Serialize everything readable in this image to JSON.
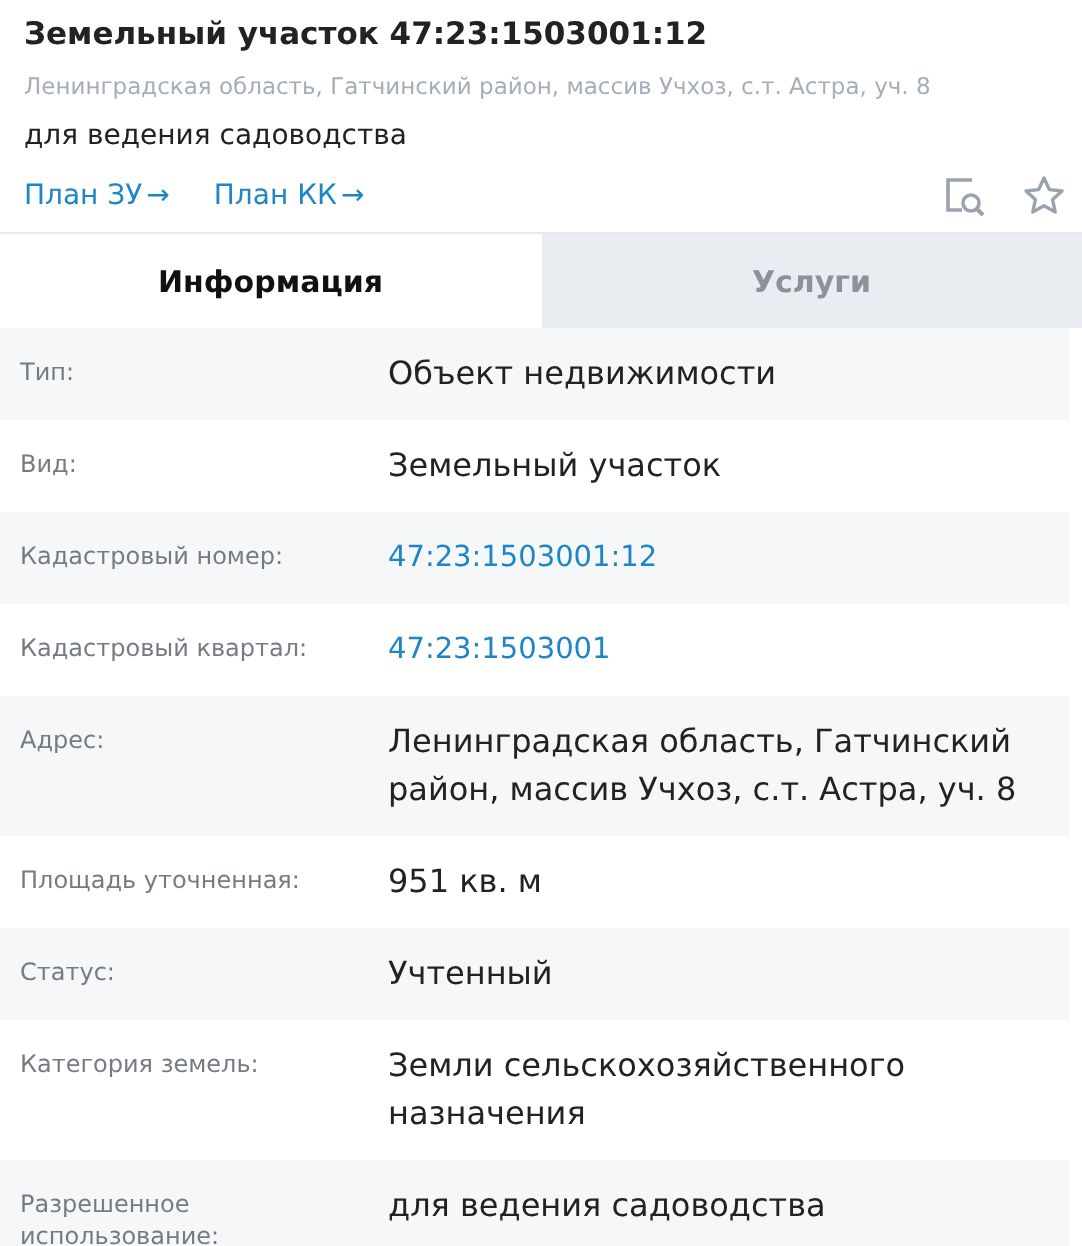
{
  "header": {
    "title": "Земельный участок 47:23:1503001:12",
    "address": "Ленинградская область, Гатчинский район, массив Учхоз, с.т. Астра, уч. 8",
    "purpose": "для ведения садоводства"
  },
  "links": [
    {
      "label": "План ЗУ",
      "arrow": "→"
    },
    {
      "label": "План КК",
      "arrow": "→"
    }
  ],
  "tabs": [
    {
      "label": "Информация",
      "selected": true
    },
    {
      "label": "Услуги",
      "selected": false
    }
  ],
  "rows": [
    {
      "label": "Тип:",
      "value": "Объект недвижимости",
      "kind": "text"
    },
    {
      "label": "Вид:",
      "value": "Земельный участок",
      "kind": "text"
    },
    {
      "label": "Кадастровый номер:",
      "value": "47:23:1503001:12",
      "kind": "link"
    },
    {
      "label": "Кадастровый квартал:",
      "value": "47:23:1503001",
      "kind": "link"
    },
    {
      "label": "Адрес:",
      "value": "Ленинградская область, Гатчинский район, массив Учхоз, с.т. Астра, уч. 8",
      "kind": "text"
    },
    {
      "label": "Площадь уточненная:",
      "value": "951 кв. м",
      "kind": "text"
    },
    {
      "label": "Статус:",
      "value": "Учтенный",
      "kind": "text"
    },
    {
      "label": "Категория земель:",
      "value": "Земли сельскохозяйственного назначения",
      "kind": "text"
    },
    {
      "label": "Разрешенное использование:",
      "value": "для ведения садоводства",
      "kind": "text"
    }
  ]
}
